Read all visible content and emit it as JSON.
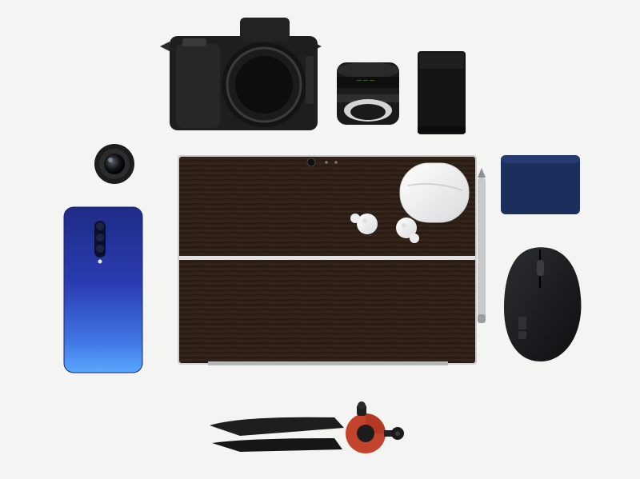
{
  "scene": {
    "background": "#f4f4f2",
    "objects": [
      {
        "name": "mirrorless-camera",
        "kind": "camera body"
      },
      {
        "name": "prime-lens",
        "kind": "camera lens"
      },
      {
        "name": "portable-battery",
        "kind": "power bank"
      },
      {
        "name": "small-lens",
        "kind": "camera lens"
      },
      {
        "name": "tablet-laptop",
        "kind": "2-in-1 tablet with wood skin"
      },
      {
        "name": "earbuds-case",
        "kind": "wireless earbuds case"
      },
      {
        "name": "earbud-left",
        "kind": "wireless earbud"
      },
      {
        "name": "earbud-right",
        "kind": "wireless earbud"
      },
      {
        "name": "stylus-pen",
        "kind": "stylus"
      },
      {
        "name": "external-ssd",
        "kind": "portable drive"
      },
      {
        "name": "smartphone",
        "kind": "phone, back side"
      },
      {
        "name": "wireless-mouse",
        "kind": "mouse"
      },
      {
        "name": "mini-tripod",
        "kind": "tabletop tripod"
      }
    ],
    "colors": {
      "wood_dark": "#2b1d15",
      "phone_blue": "#2a3aa6",
      "ssd_blue": "#1c2f5c",
      "tripod_red": "#c4432c",
      "camera_black": "#1e1e1e"
    }
  }
}
